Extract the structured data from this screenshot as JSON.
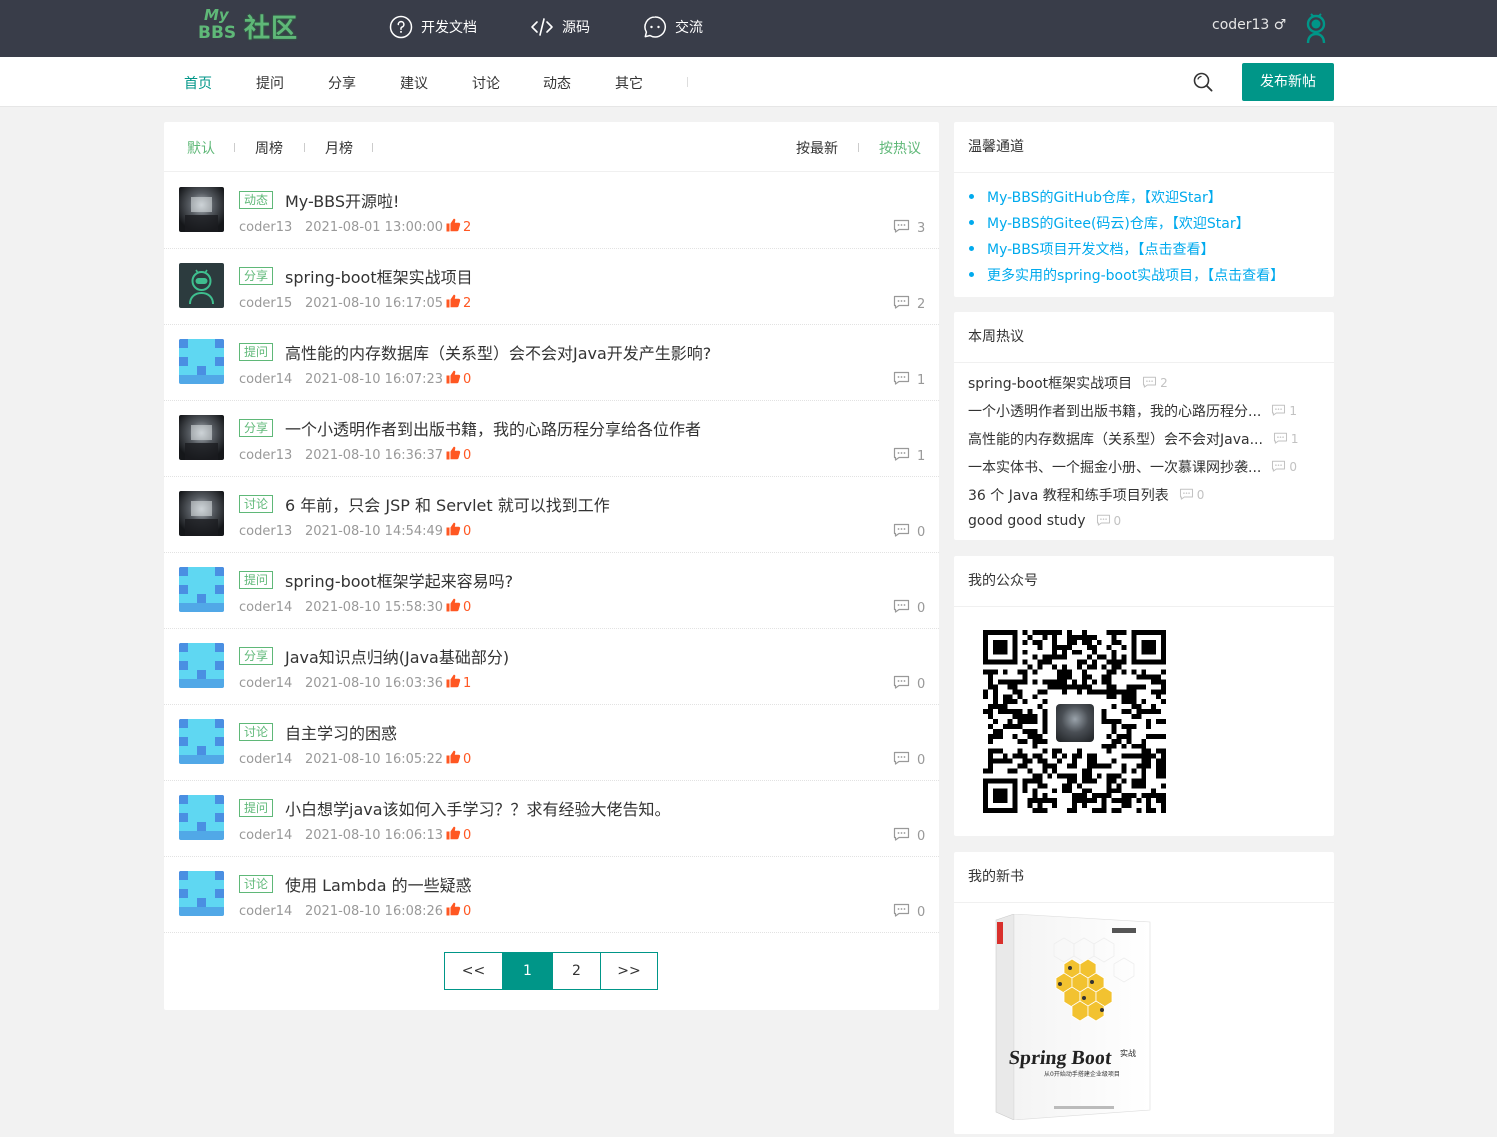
{
  "header": {
    "logo_my": "My",
    "logo_bbs": "BBS",
    "logo_community": "社区",
    "nav": [
      {
        "label": "开发文档",
        "icon": "help-circle-icon"
      },
      {
        "label": "源码",
        "icon": "code-icon"
      },
      {
        "label": "交流",
        "icon": "chat-icon"
      }
    ],
    "username": "coder13",
    "gender_symbol": "♂"
  },
  "subnav": {
    "items": [
      "首页",
      "提问",
      "分享",
      "建议",
      "讨论",
      "动态",
      "其它"
    ],
    "active_index": 0,
    "publish_label": "发布新帖"
  },
  "filter": {
    "left": [
      "默认",
      "周榜",
      "月榜"
    ],
    "right": [
      "按最新",
      "按热议"
    ],
    "active_left": 0,
    "active_right": 1
  },
  "posts": [
    {
      "avatar": "photo",
      "tag": "动态",
      "title": "My-BBS开源啦!",
      "author": "coder13",
      "time": "2021-08-01 13:00:00",
      "likes": "2",
      "replies": "3"
    },
    {
      "avatar": "robot",
      "tag": "分享",
      "title": "spring-boot框架实战项目",
      "author": "coder15",
      "time": "2021-08-10 16:17:05",
      "likes": "2",
      "replies": "2"
    },
    {
      "avatar": "pixel",
      "tag": "提问",
      "title": "高性能的内存数据库（关系型）会不会对Java开发产生影响?",
      "author": "coder14",
      "time": "2021-08-10 16:07:23",
      "likes": "0",
      "replies": "1"
    },
    {
      "avatar": "photo",
      "tag": "分享",
      "title": "一个小透明作者到出版书籍，我的心路历程分享给各位作者",
      "author": "coder13",
      "time": "2021-08-10 16:36:37",
      "likes": "0",
      "replies": "1"
    },
    {
      "avatar": "photo",
      "tag": "讨论",
      "title": "6 年前，只会 JSP 和 Servlet 就可以找到工作",
      "author": "coder13",
      "time": "2021-08-10 14:54:49",
      "likes": "0",
      "replies": "0"
    },
    {
      "avatar": "pixel",
      "tag": "提问",
      "title": "spring-boot框架学起来容易吗?",
      "author": "coder14",
      "time": "2021-08-10 15:58:30",
      "likes": "0",
      "replies": "0"
    },
    {
      "avatar": "pixel",
      "tag": "分享",
      "title": "Java知识点归纳(Java基础部分)",
      "author": "coder14",
      "time": "2021-08-10 16:03:36",
      "likes": "1",
      "replies": "0"
    },
    {
      "avatar": "pixel",
      "tag": "讨论",
      "title": "自主学习的困惑",
      "author": "coder14",
      "time": "2021-08-10 16:05:22",
      "likes": "0",
      "replies": "0"
    },
    {
      "avatar": "pixel",
      "tag": "提问",
      "title": "小白想学java该如何入手学习？？求有经验大佬告知。",
      "author": "coder14",
      "time": "2021-08-10 16:06:13",
      "likes": "0",
      "replies": "0"
    },
    {
      "avatar": "pixel",
      "tag": "讨论",
      "title": "使用 Lambda 的一些疑惑",
      "author": "coder14",
      "time": "2021-08-10 16:08:26",
      "likes": "0",
      "replies": "0"
    }
  ],
  "pager": {
    "prev": "<<",
    "pages": [
      "1",
      "2"
    ],
    "current": "1",
    "next": ">>"
  },
  "warm": {
    "title": "温馨通道",
    "links": [
      "My-BBS的GitHub仓库，【欢迎Star】",
      "My-BBS的Gitee(码云)仓库，【欢迎Star】",
      "My-BBS项目开发文档，【点击查看】",
      "更多实用的spring-boot实战项目，【点击查看】"
    ]
  },
  "hot": {
    "title": "本周热议",
    "items": [
      {
        "title": "spring-boot框架实战项目",
        "count": "2"
      },
      {
        "title": "一个小透明作者到出版书籍，我的心路历程分...",
        "count": "1"
      },
      {
        "title": "高性能的内存数据库（关系型）会不会对Java...",
        "count": "1"
      },
      {
        "title": "一本实体书、一个掘金小册、一次慕课网抄袭...",
        "count": "0"
      },
      {
        "title": "36 个 Java 教程和练手项目列表",
        "count": "0"
      },
      {
        "title": "good good study",
        "count": "0"
      }
    ]
  },
  "wechat": {
    "title": "我的公众号"
  },
  "book": {
    "title": "我的新书",
    "cover_title": "Spring Boot",
    "cover_badge": "实战",
    "cover_subtitle": "从0开始动手搭建企业级项目"
  },
  "colors": {
    "accent": "#009688",
    "green": "#5fb878",
    "like": "#ff5722",
    "link": "#01aaed",
    "header_bg": "#393d49"
  }
}
